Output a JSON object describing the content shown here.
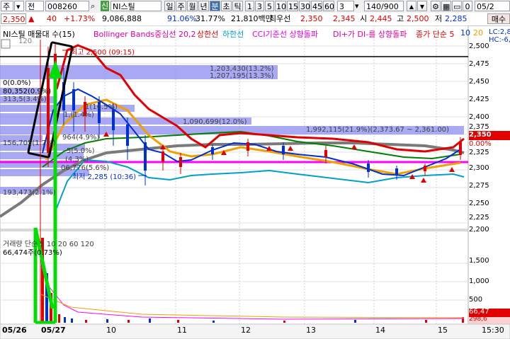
{
  "toolbar": {
    "market": "주",
    "type_select": "전",
    "code": "008260",
    "badge": "신",
    "name": "NI스틸",
    "periods": [
      "일",
      "주",
      "월",
      "년",
      "분",
      "초",
      "틱"
    ],
    "active_period": "분",
    "intervals": [
      "1",
      "3",
      "5",
      "10",
      "15",
      "30",
      "45",
      "60"
    ],
    "interval_value": "3",
    "count": "140/900",
    "small_btns": [
      "▲",
      "▼"
    ],
    "tail_btn": "0",
    "date": "05/2"
  },
  "quote": {
    "price": "2,350",
    "arrow": "▲",
    "change": "40",
    "pct": "+1.73%",
    "volume": "9,086,888",
    "pct2": "91.06%",
    "pct3": "31.77%",
    "amount": "21,810백만",
    "pri_label": "최우선",
    "ask": "2,350",
    "bid": "2,345",
    "open_label": "시",
    "open": "2,445",
    "high_label": "고",
    "high": "2,500",
    "low_label": "저",
    "low": "2,285",
    "buy_button": "매수"
  },
  "legend": {
    "title": "NI스틸 매물대 수(15)",
    "items": [
      "Bollinger Bands중심선 20,2",
      "상한선",
      "하한선",
      "CCI기준선 상향돌파",
      "DI+가 DI-를 상향돌파",
      "종가 단순 5",
      "10",
      "20"
    ],
    "lc": "LC:2,8",
    "hc": "HC:-6,"
  },
  "price_axis": [
    "2,500",
    "2,475",
    "2,450",
    "2,425",
    "2,400",
    "2,375",
    "2,350",
    "2,325",
    "2,300",
    "2,275",
    "2,250",
    "2,225",
    "2,200"
  ],
  "price_badges": {
    "cur": "2,350",
    "pct": "0.00%",
    "other": "2,325"
  },
  "annotations": {
    "high": "최고 2,500 (09:15)",
    "low": "최저 2,285 (10:36)",
    "profile_labels": [
      "1,203,430(13.2%)",
      "1,207,195(13.3%)",
      "0(0.0%)",
      "80,352(0.9%)",
      "313,5(3.4%)",
      "1(16.5%)",
      "1,(1.4%)",
      "1,090,699(12.0%)",
      "1,992,115(21.9%)(2,373.67 ~ 2,361.00)",
      "156,705(1.7%)",
      "964(4.9%)",
      "5(5.0%)",
      "(4.3%)",
      "06,776(5.6%)",
      "193,473(2.1%)"
    ],
    "side_val": "120"
  },
  "volume_panel": {
    "label": "거래량 단순 5 10 20 60 120",
    "value": "66,474주(0.73%)",
    "axis": [
      "1,500",
      "1,000",
      "500"
    ],
    "badge1": "66,47",
    "badge2": "298,6"
  },
  "x_axis": [
    "05/26",
    "05/27",
    "10",
    "11",
    "12",
    "13",
    "14",
    "15",
    "15:30"
  ],
  "colors": {
    "up": "#e00000",
    "down": "#0030d0",
    "bb_upper": "#e00000",
    "bb_lower": "#00a0c8",
    "bb_mid": "#808080",
    "ma20": "#f0a000",
    "ma60": "#008000",
    "support": "#ff00ff"
  }
}
